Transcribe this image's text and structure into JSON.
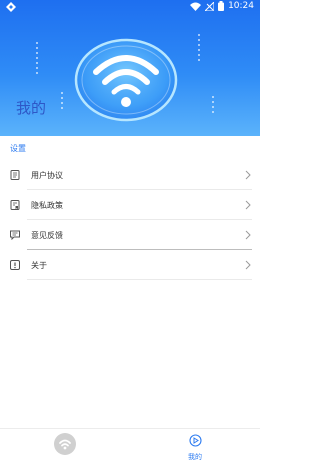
{
  "status_bar": {
    "time": "10:24",
    "icons": [
      "app-logo-icon",
      "wifi-icon",
      "no-signal-icon",
      "battery-icon"
    ]
  },
  "header": {
    "title": "我的",
    "hero_icon": "wifi-icon"
  },
  "section": {
    "label": "设置"
  },
  "menu": [
    {
      "label": "用户协议",
      "icon": "document-icon"
    },
    {
      "label": "隐私政策",
      "icon": "policy-icon"
    },
    {
      "label": "意见反馈",
      "icon": "feedback-icon"
    },
    {
      "label": "关于",
      "icon": "info-icon"
    }
  ],
  "bottom_nav": {
    "mine_label": "我的"
  },
  "colors": {
    "accent": "#2d7bf0",
    "header_top": "#1e6ff0",
    "header_bottom": "#5bb3fb"
  }
}
